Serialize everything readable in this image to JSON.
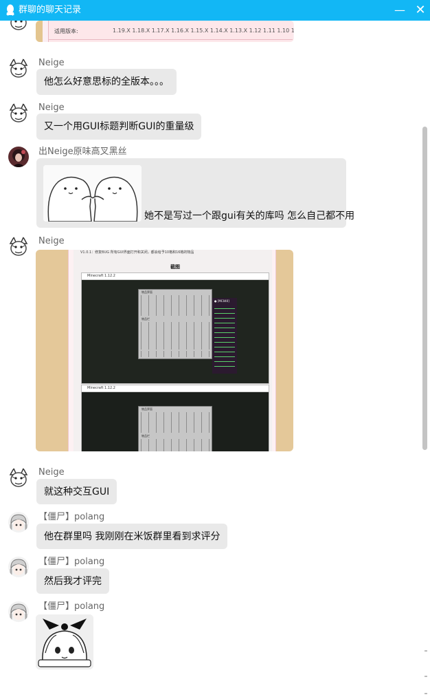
{
  "window": {
    "title": "群聊的聊天记录",
    "minimize_label": "—",
    "close_label": "✕",
    "accent": "#12b7f5"
  },
  "top_image": {
    "label": "适用版本:",
    "versions": "1.19.X 1.18.X 1.17.X 1.16.X 1.15.X 1.14.X 1.13.X 1.12 1.11 1.10 1.9 1.8"
  },
  "messages": [
    {
      "sender": "Neige",
      "text": "他怎么好意思标的全版本。。。"
    },
    {
      "sender": "Neige",
      "text": "又一个用GUI标题判断GUI的重量级"
    },
    {
      "sender": "出Neige原味高叉黑丝",
      "text": "她不是写过一个跟gui有关的库吗  怎么自己都不用"
    },
    {
      "sender": "Neige",
      "screenshot": {
        "note": "V1.0.1：修复BUG 所有GUI界面打开和关闭，都会给予10格和16格的物品",
        "heading": "截图",
        "window_title": "Minecraft 1.12.2",
        "panel_title": "物品界面",
        "panel_subtitle": "物品栏",
        "chat_header": "● [MC040]",
        "chat_line": "添加成功"
      }
    },
    {
      "sender": "Neige",
      "text": "就这种交互GUI"
    },
    {
      "sender": "【僵尸】polang",
      "text": "他在群里吗 我刚刚在米饭群里看到求评分"
    },
    {
      "sender": "【僵尸】polang",
      "text": "然后我才评完"
    },
    {
      "sender": "【僵尸】polang",
      "sticker": "anime-girl-sticker"
    }
  ]
}
